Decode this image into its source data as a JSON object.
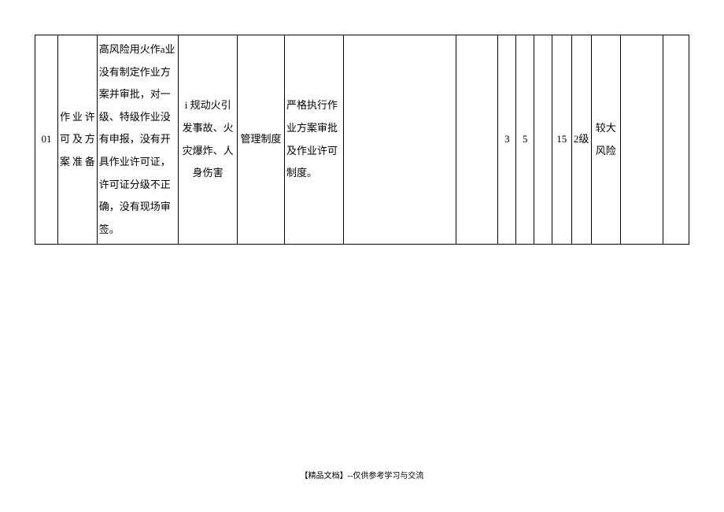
{
  "row": {
    "c0": "01",
    "c1": "作业许可及方案准备",
    "c2": "高风险用火作a业没有制定作业方案并审批，对一级、特级作业没有申报，没有开具作业许可证，许可证分级不正确，没有现场审签。",
    "c3": "i 规动火引发事故、火灾爆炸、人\n身伤害",
    "c4": "管理制度",
    "c5": "严格执行作业方案审批及作业许可制度。",
    "c6": "",
    "c7": "",
    "c8": "3",
    "c9": "5",
    "c10": "",
    "c11": "15",
    "c12": "2级",
    "c13": "较大风险",
    "c14": "",
    "c15": ""
  },
  "footer": "【精品文档】--仅供参考学习与交流"
}
